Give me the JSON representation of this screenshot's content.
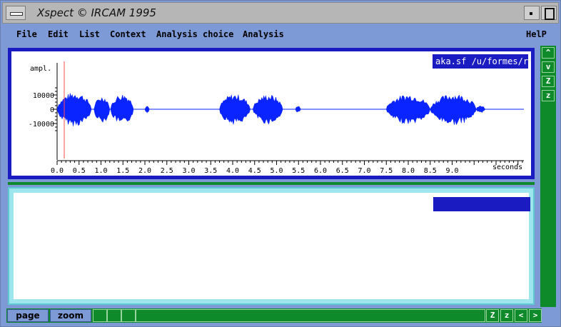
{
  "window": {
    "title": "Xspect © IRCAM 1995",
    "icons": [
      "window-menu-icon",
      "minimize-icon",
      "maximize-icon"
    ]
  },
  "menu": {
    "items": [
      "File",
      "Edit",
      "List",
      "Context",
      "Analysis choice",
      "Analysis"
    ],
    "help": "HelP"
  },
  "waveform": {
    "file_label": "aka.sf /u/formes/r",
    "y_label": "ampl.",
    "x_label": "seconds",
    "y_ticks": [
      "10000",
      "0",
      "-10000"
    ],
    "x_ticks": [
      "0.0",
      "0.5",
      "1.0",
      "1.5",
      "2.0",
      "2.5",
      "3.0",
      "3.5",
      "4.0",
      "4.5",
      "5.0",
      "5.5",
      "6.0",
      "6.5",
      "7.0",
      "7.5",
      "8.0",
      "8.5",
      "9.0"
    ],
    "color": "#0a24ff",
    "cursor_color": "#ff4b4b"
  },
  "analysis": {
    "label": ""
  },
  "scroll": {
    "up": "^",
    "down": "v",
    "zoom_in": "Z",
    "zoom_out": "z"
  },
  "bottom": {
    "page": "page",
    "zoom": "zoom",
    "zoom_in": "Z",
    "zoom_out": "z",
    "left": "<",
    "right": ">"
  },
  "colors": {
    "panel_blue": "#1b1bc2",
    "scroll_green": "#0e8a2a",
    "analysis_cyan": "#9ee6ee",
    "background": "#7d99d6"
  }
}
